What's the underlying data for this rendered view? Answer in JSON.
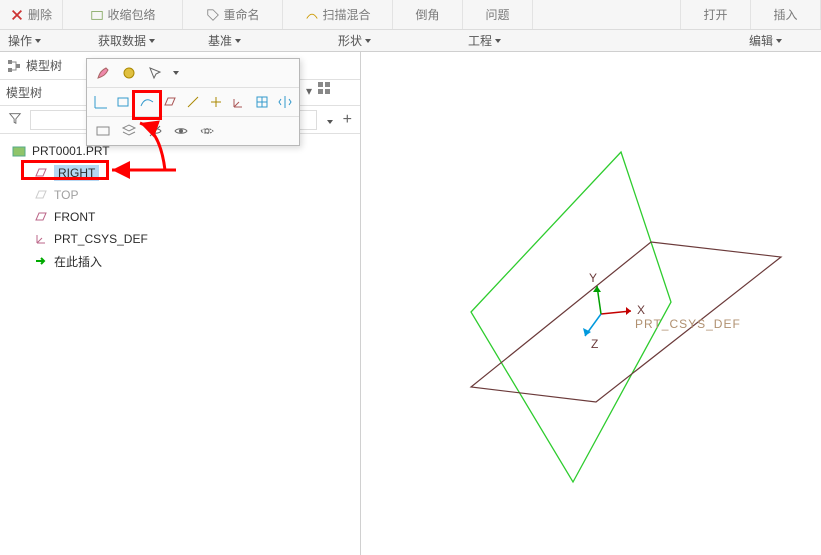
{
  "ribbon_top": {
    "delete": "删除",
    "pack": "收缩包络",
    "rename": "重命名",
    "sweep": "扫描混合",
    "other1": "倒角",
    "other2": "问题",
    "publish": "打开",
    "insert": "插入"
  },
  "ribbon_groups": {
    "operate": "操作",
    "getdata": "获取数据",
    "reference": "基准",
    "shape": "形状",
    "engineering": "工程",
    "edit": "编辑"
  },
  "panel": {
    "model_tree_tab": "模型树",
    "model_tree_label": "模型树"
  },
  "tree": {
    "root": "PRT0001.PRT",
    "items": [
      {
        "label": "RIGHT",
        "type": "plane",
        "state": "selected"
      },
      {
        "label": "TOP",
        "type": "plane",
        "state": "dim"
      },
      {
        "label": "FRONT",
        "type": "plane",
        "state": "normal"
      },
      {
        "label": "PRT_CSYS_DEF",
        "type": "csys",
        "state": "normal"
      },
      {
        "label": "在此插入",
        "type": "insert",
        "state": "normal"
      }
    ]
  },
  "viewport": {
    "csys_label": "PRT_CSYS_DEF",
    "axes": {
      "x": "X",
      "y": "Y",
      "z": "Z"
    },
    "colors": {
      "plane_green": "#2ecc2e",
      "plane_maroon": "#6b3a3a",
      "axis_x": "#c40000",
      "axis_y": "#00a000",
      "axis_z": "#0099dd",
      "label": "#b09070"
    }
  },
  "highlights": {
    "arrow_to_eye": true,
    "arrow_to_right": true
  }
}
